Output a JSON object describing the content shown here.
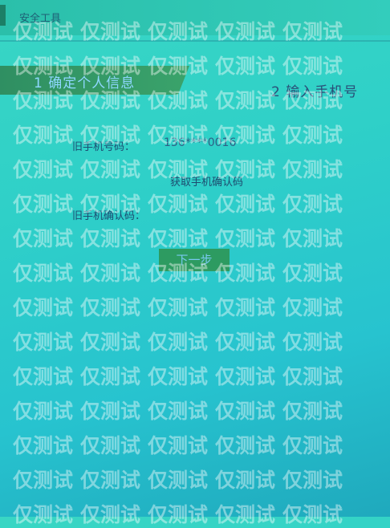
{
  "header": {
    "title": "安全工具"
  },
  "steps": {
    "step1": "1 确定个人信息",
    "step2": "2 输入手机号"
  },
  "form": {
    "old_phone_label": "旧手机号码：",
    "old_phone_value": "136****0016",
    "get_code_button": "获取手机确认码",
    "old_code_label": "旧手机确认码："
  },
  "actions": {
    "next_button": "下一步"
  },
  "watermark": {
    "text": "仅测试"
  }
}
